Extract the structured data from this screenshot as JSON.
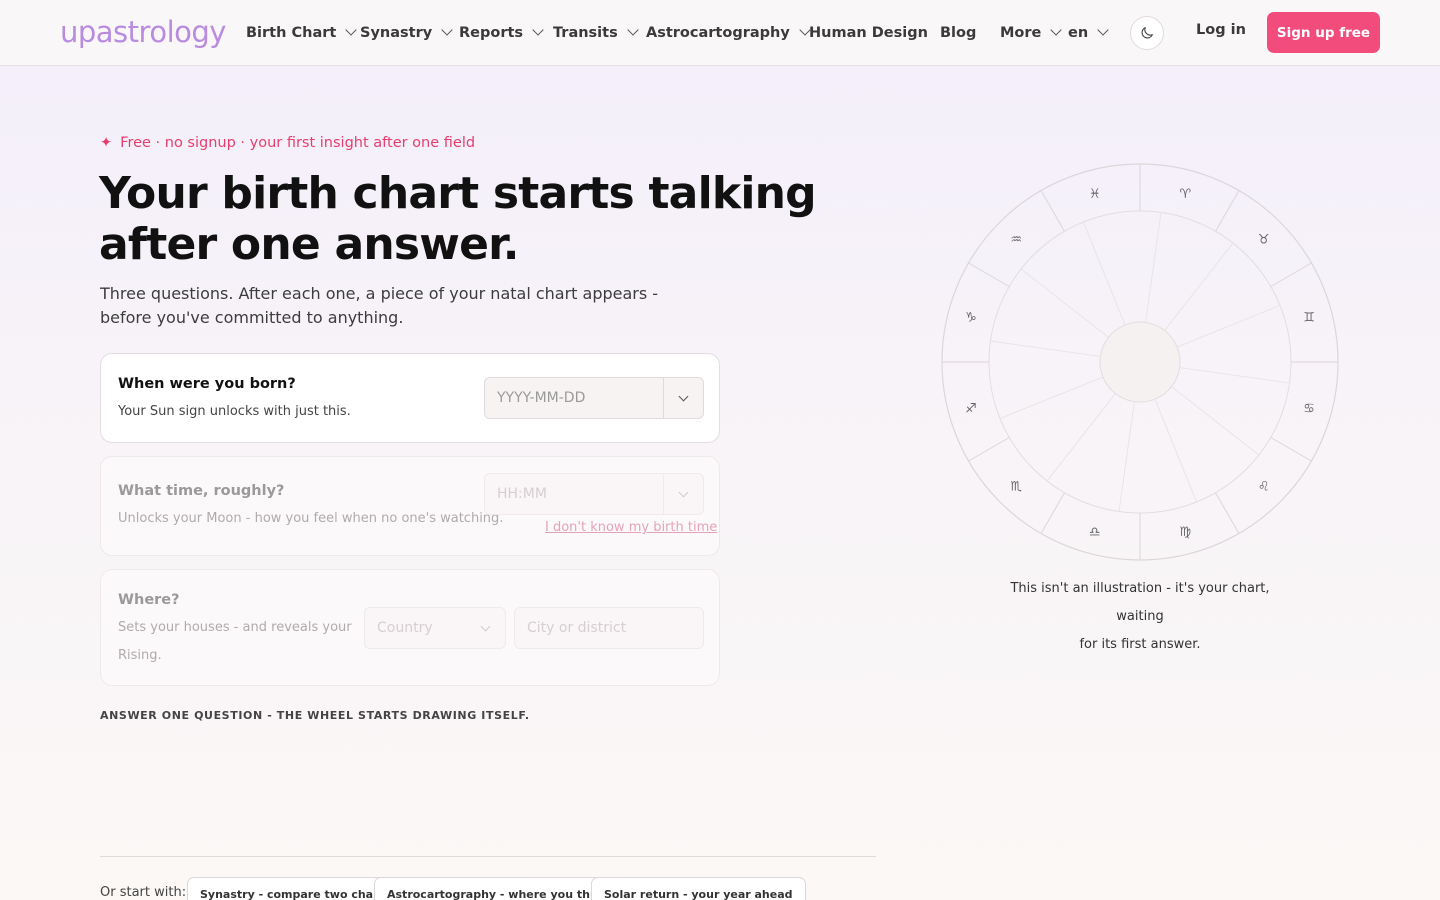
{
  "header": {
    "logo": "upastrology",
    "nav": [
      {
        "label": "Birth Chart",
        "dropdown": true
      },
      {
        "label": "Synastry",
        "dropdown": true
      },
      {
        "label": "Reports",
        "dropdown": true
      },
      {
        "label": "Transits",
        "dropdown": true
      },
      {
        "label": "Astrocartography",
        "dropdown": true
      },
      {
        "label": "Human Design",
        "dropdown": false
      },
      {
        "label": "Blog",
        "dropdown": false
      },
      {
        "label": "More",
        "dropdown": true
      },
      {
        "label": "en",
        "dropdown": true
      }
    ],
    "theme_icon": "moon-icon",
    "login": "Log in",
    "signup": "Sign up free"
  },
  "hero": {
    "eyebrow_icon": "✦",
    "eyebrow": "Free · no signup · your first insight after one field",
    "title": "Your birth chart starts talking after one answer.",
    "subtitle": "Three questions. After each one, a piece of your natal chart appears - before you've committed to anything."
  },
  "form": {
    "date": {
      "question": "When were you born?",
      "hint": "Your Sun sign unlocks with just this.",
      "placeholder": "YYYY-MM-DD"
    },
    "time": {
      "question": "What time, roughly?",
      "hint": "Unlocks your Moon - how you feel when no one's watching.",
      "placeholder": "HH:MM",
      "unknown_link": "I don't know my birth time"
    },
    "place": {
      "question": "Where?",
      "hint_line1": "Sets your houses - and reveals your",
      "hint_line2": "Rising.",
      "country_placeholder": "Country",
      "city_placeholder": "City or district"
    },
    "note": "ANSWER ONE QUESTION - THE WHEEL STARTS DRAWING ITSELF."
  },
  "footer": {
    "or_start": "Or start with:",
    "pills": [
      "Synastry - compare two charts",
      "Astrocartography - where you thrive",
      "Solar return - your year ahead"
    ]
  },
  "wheel": {
    "signs": [
      "♓",
      "♈",
      "♉",
      "♊",
      "♋",
      "♌",
      "♍",
      "♎",
      "♏",
      "♐",
      "♑",
      "♒"
    ],
    "caption_line1": "This isn't an illustration - it's your chart, waiting",
    "caption_line2": "for its first answer."
  }
}
